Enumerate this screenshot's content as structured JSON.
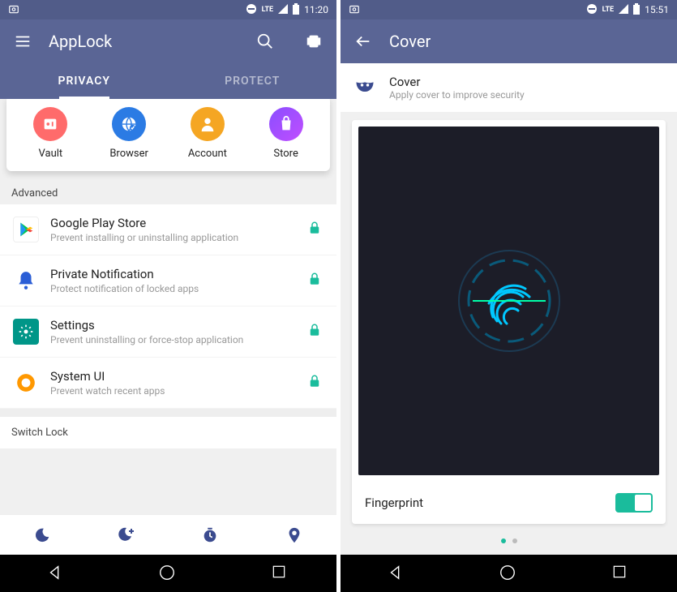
{
  "left": {
    "status": {
      "time": "11:20",
      "net": "LTE"
    },
    "appbar": {
      "title": "AppLock"
    },
    "tabs": [
      "PRIVACY",
      "PROTECT"
    ],
    "quick": [
      {
        "label": "Vault",
        "color": "#ff6b6b",
        "icon": "vault"
      },
      {
        "label": "Browser",
        "color": "#2b7be4",
        "icon": "browser"
      },
      {
        "label": "Account",
        "color": "#f5a623",
        "icon": "account"
      },
      {
        "label": "Store",
        "color": "#8a4eff",
        "icon": "store"
      }
    ],
    "section1": "Advanced",
    "items": [
      {
        "title": "Google Play Store",
        "sub": "Prevent installing or uninstalling application",
        "iconBg": "#fff",
        "locked": true
      },
      {
        "title": "Private Notification",
        "sub": "Protect notification of locked apps",
        "iconBg": "#2b5ed6",
        "locked": true
      },
      {
        "title": "Settings",
        "sub": "Prevent uninstalling or force-stop application",
        "iconBg": "#009688",
        "locked": true
      },
      {
        "title": "System UI",
        "sub": "Prevent watch recent apps",
        "iconBg": "#ff9800",
        "locked": true
      }
    ],
    "section2": "Switch Lock"
  },
  "right": {
    "status": {
      "time": "15:51",
      "net": "LTE"
    },
    "appbar": {
      "title": "Cover"
    },
    "header": {
      "title": "Cover",
      "sub": "Apply cover to improve security"
    },
    "card": {
      "label": "Fingerprint",
      "toggled": true
    },
    "pages": {
      "count": 2,
      "active": 0
    }
  }
}
